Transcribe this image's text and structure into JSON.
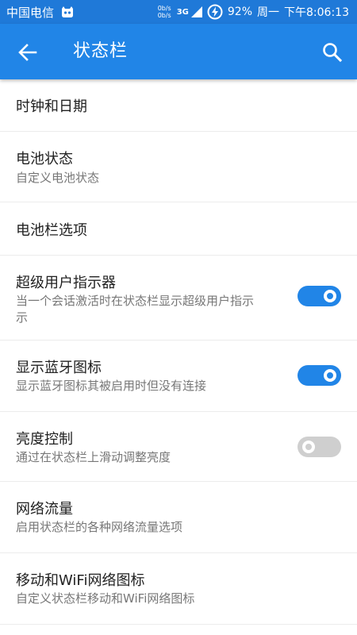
{
  "status_bar": {
    "carrier": "中国电信",
    "net_speed_up": "0b/s",
    "net_speed_down": "0b/s",
    "network_type": "3G",
    "battery": "92%",
    "weekday": "周一",
    "time": "下午8:06:13"
  },
  "app_bar": {
    "title": "状态栏",
    "back_icon": "arrow-left-icon",
    "search_icon": "search-icon"
  },
  "items": [
    {
      "title": "时钟和日期",
      "summary": ""
    },
    {
      "title": "电池状态",
      "summary": "自定义电池状态"
    },
    {
      "title": "电池栏选项",
      "summary": ""
    },
    {
      "title": "超级用户指示器",
      "summary": "当一个会话激活时在状态栏显示超级用户指示",
      "summary_line2": "示",
      "toggle_on": true
    },
    {
      "title": "显示蓝牙图标",
      "summary": "显示蓝牙图标其被启用时但没有连接",
      "toggle_on": true
    },
    {
      "title": "亮度控制",
      "summary": "通过在状态栏上滑动调整亮度",
      "toggle_on": false
    },
    {
      "title": "网络流量",
      "summary": "启用状态栏的各种网络流量选项"
    },
    {
      "title": "移动和WiFi网络图标",
      "summary": "自定义状态栏移动和WiFi网络图标"
    }
  ],
  "colors": {
    "status_bar": "#1f79d8",
    "app_bar": "#2185e7",
    "accent": "#2185e7",
    "toggle_off": "#cfcfcf"
  }
}
